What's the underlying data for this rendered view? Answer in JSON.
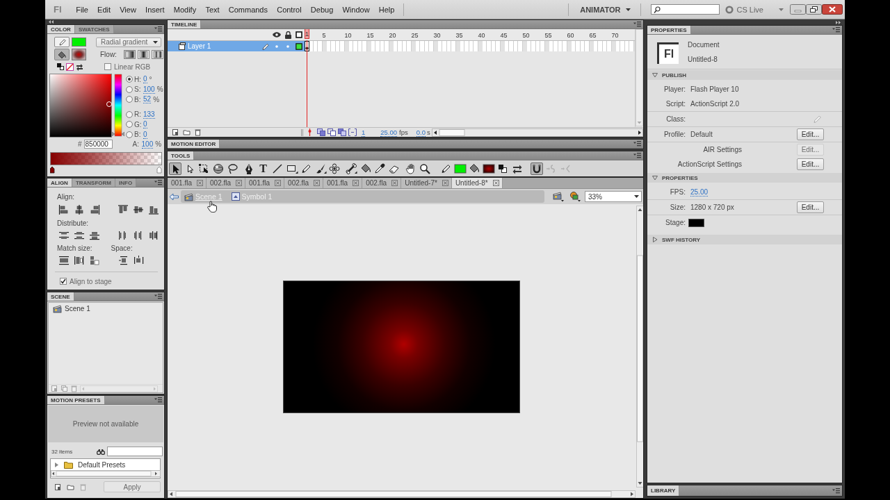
{
  "menu_bar": {
    "logo": "Fl",
    "items": [
      "File",
      "Edit",
      "View",
      "Insert",
      "Modify",
      "Text",
      "Commands",
      "Control",
      "Debug",
      "Window",
      "Help"
    ],
    "workspace": "ANIMATOR",
    "cs_live": "CS Live"
  },
  "color_panel": {
    "tabs": [
      {
        "label": "COLOR",
        "selected": true
      },
      {
        "label": "SWATCHES",
        "selected": false
      }
    ],
    "targets": [
      {
        "kind": "stroke",
        "selected": false
      },
      {
        "kind": "fill",
        "selected": true
      }
    ],
    "fill_type": "Radial gradient",
    "flow_label": "Flow:",
    "flow_modes": [
      {
        "kind": "extend",
        "selected": true
      },
      {
        "kind": "reflect",
        "selected": false
      },
      {
        "kind": "repeat",
        "selected": false
      }
    ],
    "linear_rgb": {
      "label": "Linear RGB",
      "checked": false
    },
    "hue_slider": {
      "level": 0
    },
    "hsb": [
      {
        "label": "H:",
        "value": "0",
        "unit": "°",
        "selected": true
      },
      {
        "label": "S:",
        "value": "100",
        "unit": "%",
        "selected": false
      },
      {
        "label": "B:",
        "value": "52",
        "unit": "%",
        "selected": false
      }
    ],
    "rgb": [
      {
        "label": "R:",
        "value": "133",
        "selected": false
      },
      {
        "label": "G:",
        "value": "0",
        "selected": false
      },
      {
        "label": "B:",
        "value": "0",
        "selected": false
      }
    ],
    "hex_label": "#",
    "hex": "850000",
    "alpha": {
      "label": "A:",
      "value": "100",
      "unit": "%"
    }
  },
  "align_panel": {
    "tabs": [
      {
        "label": "ALIGN",
        "selected": true
      },
      {
        "label": "TRANSFORM",
        "selected": false
      },
      {
        "label": "INFO",
        "selected": false
      }
    ],
    "align_label": "Align:",
    "distribute_label": "Distribute:",
    "match_label": "Match size:",
    "space_label": "Space:",
    "align_to_stage": {
      "label": "Align to stage",
      "checked": true
    }
  },
  "scene_panel": {
    "title": "SCENE",
    "scenes": [
      "Scene 1"
    ]
  },
  "motion_presets": {
    "title": "MOTION PRESETS",
    "preview": "Preview not available",
    "count": "32 items",
    "folders": [
      {
        "name": "Default Presets",
        "expanded": false
      }
    ],
    "apply": {
      "label": "Apply",
      "disabled": true
    }
  },
  "timeline": {
    "title": "TIMELINE",
    "frames": [
      {
        "label": "1",
        "selected": true
      },
      {
        "label": "5",
        "selected": false
      },
      {
        "label": "10",
        "selected": false
      },
      {
        "label": "15",
        "selected": false
      },
      {
        "label": "20",
        "selected": false
      },
      {
        "label": "25",
        "selected": false
      },
      {
        "label": "30",
        "selected": false
      },
      {
        "label": "35",
        "selected": false
      },
      {
        "label": "40",
        "selected": false
      },
      {
        "label": "45",
        "selected": false
      },
      {
        "label": "50",
        "selected": false
      },
      {
        "label": "55",
        "selected": false
      },
      {
        "label": "60",
        "selected": false
      },
      {
        "label": "65",
        "selected": false
      },
      {
        "label": "70",
        "selected": false
      }
    ],
    "layers": [
      {
        "name": "Layer 1",
        "selected": true
      }
    ],
    "current_frame": "1",
    "fps": "25.00",
    "fps_unit": "fps",
    "elapsed": "0.0",
    "elapsed_unit": "s"
  },
  "motion_editor": {
    "title": "MOTION EDITOR"
  },
  "tools": {
    "title": "TOOLS",
    "groups": [
      [
        {
          "kind": "selection",
          "selected": true,
          "disabled": false
        },
        {
          "kind": "subselection",
          "selected": false,
          "disabled": false
        },
        {
          "kind": "free_transform",
          "selected": false,
          "disabled": false
        },
        {
          "kind": "rotate_3d",
          "selected": false,
          "disabled": false
        },
        {
          "kind": "lasso",
          "selected": false,
          "disabled": false
        }
      ],
      [
        {
          "kind": "pen",
          "selected": false,
          "disabled": false
        },
        {
          "kind": "text",
          "glyph": "T",
          "selected": false,
          "disabled": false
        },
        {
          "kind": "line",
          "selected": false,
          "disabled": false
        },
        {
          "kind": "rectangle",
          "selected": false,
          "disabled": false
        },
        {
          "kind": "pencil",
          "selected": false,
          "disabled": false
        },
        {
          "kind": "brush",
          "selected": false,
          "disabled": false
        },
        {
          "kind": "deco",
          "selected": false,
          "disabled": false
        }
      ],
      [
        {
          "kind": "bone",
          "selected": false,
          "disabled": false
        },
        {
          "kind": "paint_bucket",
          "selected": false,
          "disabled": false
        },
        {
          "kind": "eyedropper",
          "selected": false,
          "disabled": false
        },
        {
          "kind": "eraser",
          "selected": false,
          "disabled": false
        }
      ],
      [
        {
          "kind": "hand",
          "selected": false,
          "disabled": false
        },
        {
          "kind": "zoom",
          "selected": false,
          "disabled": false
        }
      ],
      [
        {
          "kind": "stroke_icon",
          "selected": false,
          "disabled": false
        },
        {
          "kind": "stroke_swatch",
          "selected": false,
          "disabled": false
        },
        {
          "kind": "fill_icon",
          "selected": false,
          "disabled": false
        },
        {
          "kind": "fill_swatch",
          "selected": false,
          "disabled": false
        },
        {
          "kind": "default_colors",
          "selected": false,
          "disabled": false
        },
        {
          "kind": "swap_colors",
          "selected": false,
          "disabled": false
        }
      ],
      [
        {
          "kind": "snap",
          "selected": true,
          "disabled": false
        },
        {
          "kind": "smooth",
          "selected": false,
          "disabled": true
        },
        {
          "kind": "straighten",
          "selected": false,
          "disabled": true
        }
      ]
    ]
  },
  "documents": [
    {
      "name": "001.fla",
      "selected": false
    },
    {
      "name": "002.fla",
      "selected": false
    },
    {
      "name": "001.fla",
      "selected": false
    },
    {
      "name": "002.fla",
      "selected": false
    },
    {
      "name": "001.fla",
      "selected": false
    },
    {
      "name": "002.fla",
      "selected": false
    },
    {
      "name": "Untitled-7*",
      "selected": false
    },
    {
      "name": "Untitled-8*",
      "selected": true
    }
  ],
  "edit_bar": {
    "crumbs": [
      {
        "kind": "scene",
        "name": "Scene 1",
        "hovered": true
      },
      {
        "kind": "symbol",
        "name": "Symbol 1",
        "hovered": false
      }
    ],
    "zoom": "33%"
  },
  "properties": {
    "title": "PROPERTIES",
    "doc_icon": "Fl",
    "doc_type": "Document",
    "doc_name": "Untitled-8",
    "sections": [
      {
        "title": "PUBLISH",
        "expanded": true,
        "groups": [
          [
            {
              "kind": "field",
              "label": "Player:",
              "value": "Flash Player 10"
            },
            {
              "kind": "field",
              "label": "Script:",
              "value": "ActionScript 2.0"
            }
          ],
          [
            {
              "kind": "class",
              "label": "Class:"
            }
          ],
          [
            {
              "kind": "field",
              "label": "Profile:",
              "value": "Default",
              "button": {
                "label": "Edit...",
                "disabled": false
              }
            }
          ],
          [
            {
              "kind": "setting",
              "label": "AIR Settings",
              "button": {
                "label": "Edit...",
                "disabled": true
              }
            },
            {
              "kind": "setting",
              "label": "ActionScript Settings",
              "button": {
                "label": "Edit...",
                "disabled": false
              }
            }
          ]
        ]
      },
      {
        "title": "PROPERTIES",
        "expanded": true,
        "groups": [
          [
            {
              "kind": "link",
              "label": "FPS:",
              "value": "25.00"
            }
          ],
          [
            {
              "kind": "field",
              "label": "Size:",
              "value": "1280 x 720 px",
              "button": {
                "label": "Edit...",
                "disabled": false
              }
            }
          ],
          [
            {
              "kind": "swatch",
              "label": "Stage:",
              "color": "#000000"
            }
          ]
        ]
      },
      {
        "title": "SWF HISTORY",
        "expanded": false
      }
    ]
  },
  "library": {
    "title": "LIBRARY"
  }
}
